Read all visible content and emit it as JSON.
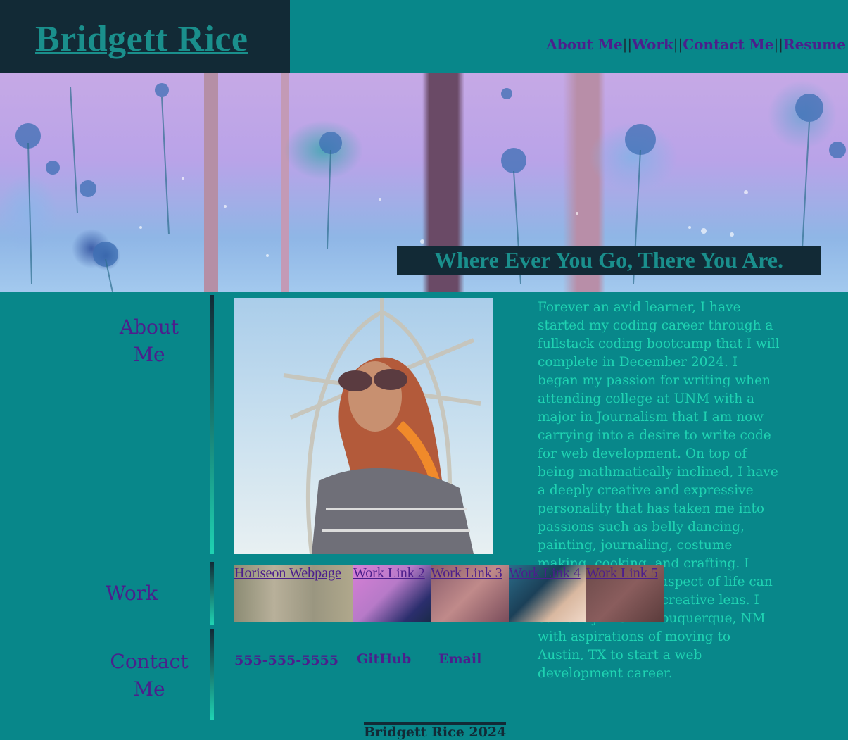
{
  "header": {
    "logo": "Bridgett Rice",
    "nav": [
      "About Me",
      "Work",
      "Contact Me",
      "Resume"
    ]
  },
  "hero": {
    "tagline": "Where Ever You Go, There You Are."
  },
  "about": {
    "heading_line1": "About",
    "heading_line2": "Me",
    "text": "Forever an avid learner, I have started my coding career through a fullstack coding bootcamp that I will complete in December 2024. I began my passion for writing when attending college at UNM with a major in Journalism that I am now carrying into a desire to write code for web development. On top of being mathmatically inclined, I have a deeply creative and expressive personality that has taken me into passions such as belly dancing, painting, journaling, costume making, cooking, and crafting. I believe that every aspect of life can be seen through a creative lens. I currently live in Albuquerque, NM with aspirations of moving to Austin, TX to start a web development career."
  },
  "work": {
    "heading": "Work",
    "links": [
      "Horiseon Webpage",
      "Work Link 2",
      "Work Link 3",
      "Work Link 4",
      "Work Link 5"
    ]
  },
  "contact": {
    "heading_line1": "Contact",
    "heading_line2": "Me",
    "phone": "555-555-5555",
    "github": "GitHub",
    "email": "Email"
  },
  "footer": {
    "text": "Bridgett Rice 2024"
  },
  "colors": {
    "background": "#08878a",
    "dark": "#122a36",
    "accent_purple": "#4c1f8c",
    "accent_teal": "#1fd3b2"
  }
}
